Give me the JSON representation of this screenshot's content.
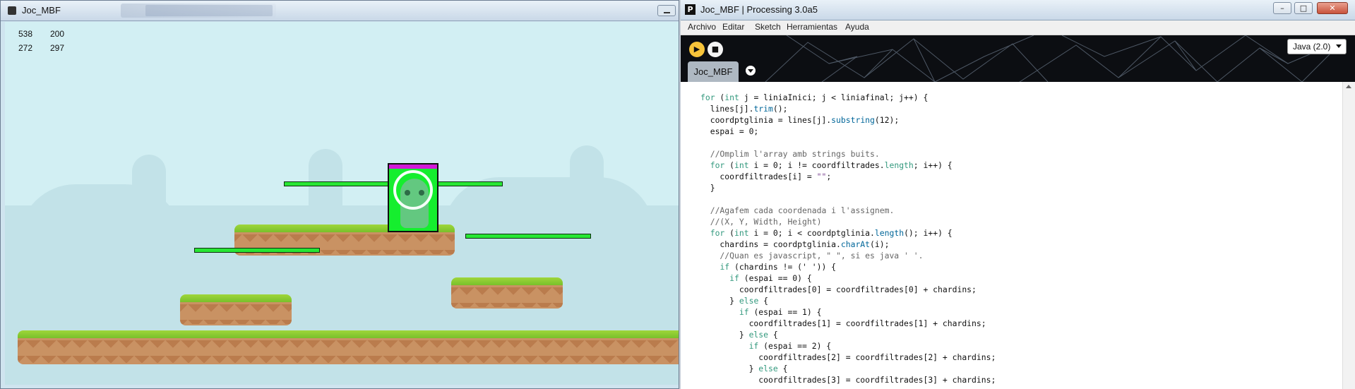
{
  "game_window": {
    "title": "Joc_MBF",
    "counters": {
      "row1": [
        "538",
        "200"
      ],
      "row2": [
        "272",
        "297"
      ]
    }
  },
  "ide_window": {
    "title": "Joc_MBF | Processing 3.0a5",
    "app_icon_letter": "P",
    "window_buttons": {
      "minimize": "–",
      "maximize": "□",
      "close": "✕"
    },
    "menu": [
      "Archivo",
      "Editar",
      "Sketch",
      "Herramientas",
      "Ayuda"
    ],
    "toolbar": {
      "run_symbol": "▶",
      "stop_symbol": "■",
      "mode": "Java (2.0)"
    },
    "tab": "Joc_MBF",
    "code_lines": [
      [
        [
          "kw",
          "for"
        ],
        [
          "t",
          " ("
        ],
        [
          "kw",
          "int"
        ],
        [
          "t",
          " j = liniaInici; j < liniafinal; j++) {"
        ]
      ],
      [
        [
          "t",
          "  lines[j]."
        ],
        [
          "fn",
          "trim"
        ],
        [
          "t",
          "();"
        ]
      ],
      [
        [
          "t",
          "  coordptglinia = lines[j]."
        ],
        [
          "fn",
          "substring"
        ],
        [
          "t",
          "(12);"
        ]
      ],
      [
        [
          "t",
          "  espai = 0;"
        ]
      ],
      [
        [
          "t",
          ""
        ]
      ],
      [
        [
          "cm",
          "  //Omplim l'array amb strings buits."
        ]
      ],
      [
        [
          "t",
          "  "
        ],
        [
          "kw",
          "for"
        ],
        [
          "t",
          " ("
        ],
        [
          "kw",
          "int"
        ],
        [
          "t",
          " i = 0; i != coordfiltrades."
        ],
        [
          "kw",
          "length"
        ],
        [
          "t",
          "; i++) {"
        ]
      ],
      [
        [
          "t",
          "    coordfiltrades[i] = "
        ],
        [
          "st",
          "\"\""
        ],
        [
          "t",
          ";"
        ]
      ],
      [
        [
          "t",
          "  }"
        ]
      ],
      [
        [
          "t",
          ""
        ]
      ],
      [
        [
          "cm",
          "  //Agafem cada coordenada i l'assignem."
        ]
      ],
      [
        [
          "cm",
          "  //(X, Y, Width, Height)"
        ]
      ],
      [
        [
          "t",
          "  "
        ],
        [
          "kw",
          "for"
        ],
        [
          "t",
          " ("
        ],
        [
          "kw",
          "int"
        ],
        [
          "t",
          " i = 0; i < coordptglinia."
        ],
        [
          "fn",
          "length"
        ],
        [
          "t",
          "(); i++) {"
        ]
      ],
      [
        [
          "t",
          "    chardins = coordptglinia."
        ],
        [
          "fn",
          "charAt"
        ],
        [
          "t",
          "(i);"
        ]
      ],
      [
        [
          "cm",
          "    //Quan es javascript, \" \", si es java ' '."
        ]
      ],
      [
        [
          "t",
          "    "
        ],
        [
          "kw",
          "if"
        ],
        [
          "t",
          " (chardins != (' ')) {"
        ]
      ],
      [
        [
          "t",
          "      "
        ],
        [
          "kw",
          "if"
        ],
        [
          "t",
          " (espai == 0) {"
        ]
      ],
      [
        [
          "t",
          "        coordfiltrades[0] = coordfiltrades[0] + chardins;"
        ]
      ],
      [
        [
          "t",
          "      } "
        ],
        [
          "kw",
          "else"
        ],
        [
          "t",
          " {"
        ]
      ],
      [
        [
          "t",
          "        "
        ],
        [
          "kw",
          "if"
        ],
        [
          "t",
          " (espai == 1) {"
        ]
      ],
      [
        [
          "t",
          "          coordfiltrades[1] = coordfiltrades[1] + chardins;"
        ]
      ],
      [
        [
          "t",
          "        } "
        ],
        [
          "kw",
          "else"
        ],
        [
          "t",
          " {"
        ]
      ],
      [
        [
          "t",
          "          "
        ],
        [
          "kw",
          "if"
        ],
        [
          "t",
          " (espai == 2) {"
        ]
      ],
      [
        [
          "t",
          "            coordfiltrades[2] = coordfiltrades[2] + chardins;"
        ]
      ],
      [
        [
          "t",
          "          } "
        ],
        [
          "kw",
          "else"
        ],
        [
          "t",
          " {"
        ]
      ],
      [
        [
          "t",
          "            coordfiltrades[3] = coordfiltrades[3] + chardins;"
        ]
      ]
    ]
  },
  "colors": {
    "keyword": "#33997e",
    "function": "#006699",
    "comment": "#666666",
    "string": "#7d4793",
    "platform_grass": "#78c02b",
    "platform_dirt": "#c99263",
    "collision_box": "#15ee2e",
    "collision_top": "#d21ad8"
  }
}
